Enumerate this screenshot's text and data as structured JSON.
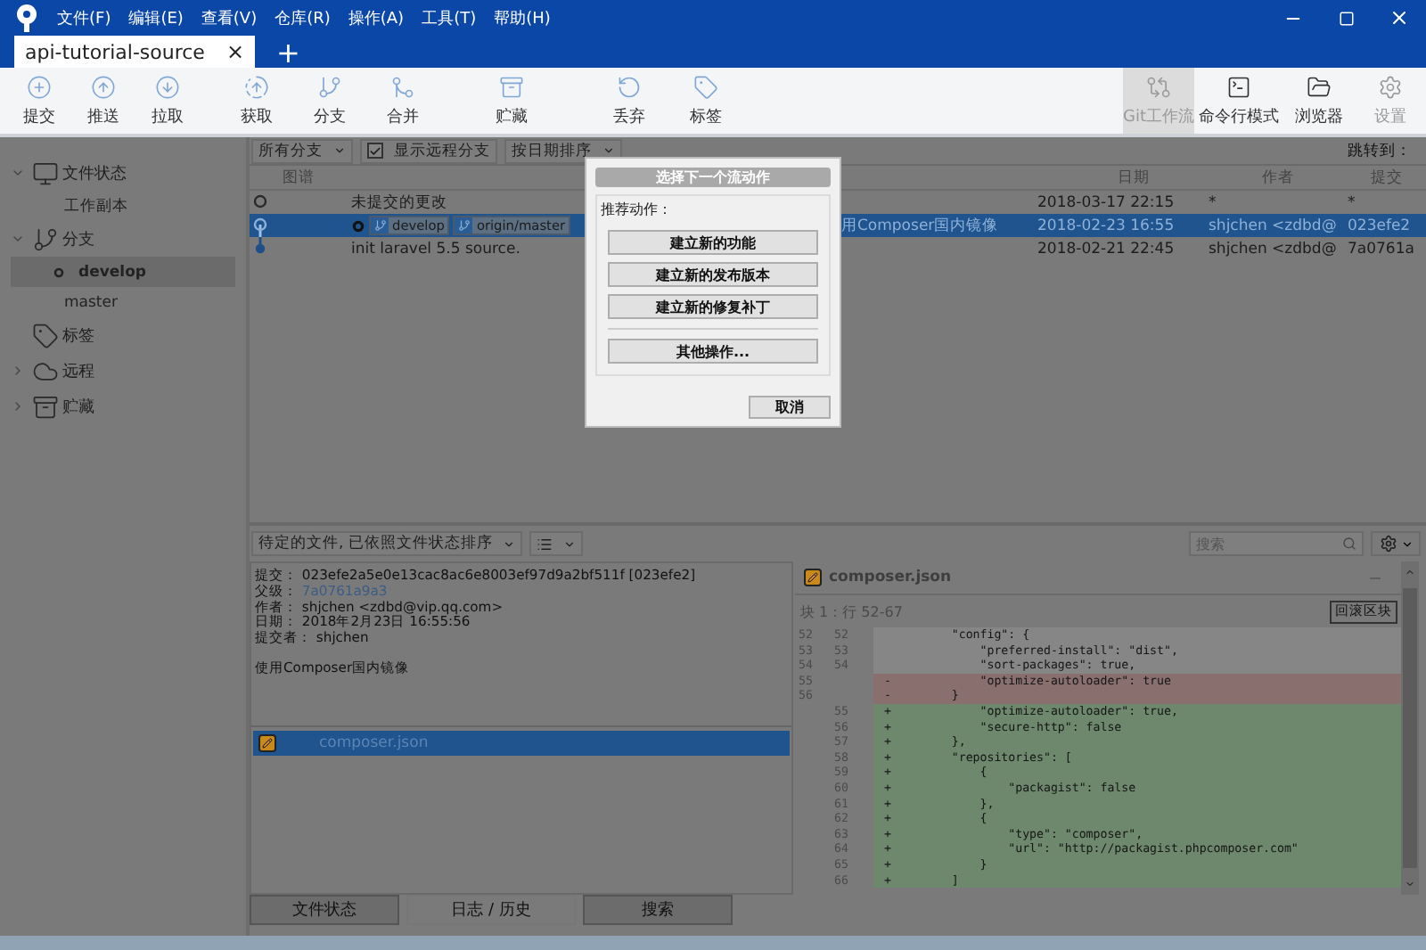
{
  "menu": [
    "文件(F)",
    "编辑(E)",
    "查看(V)",
    "仓库(R)",
    "操作(A)",
    "工具(T)",
    "帮助(H)"
  ],
  "tabs": [
    {
      "label": "api-tutorial-source",
      "selected": true,
      "close": "×"
    },
    {
      "label": "+",
      "selected": false
    }
  ],
  "toolbar": {
    "left": [
      {
        "label": "提交"
      },
      {
        "label": "推送"
      },
      {
        "label": "拉取"
      },
      {
        "label": "获取"
      },
      {
        "label": "分支"
      },
      {
        "label": "合并"
      },
      {
        "label": "贮藏"
      },
      {
        "label": "丢弃"
      },
      {
        "label": "标签"
      }
    ],
    "right": [
      {
        "label": "Git工作流",
        "selected": true,
        "disabled": true
      },
      {
        "label": "命令行模式",
        "selected": false,
        "disabled": false
      },
      {
        "label": "浏览器",
        "selected": false,
        "disabled": false
      },
      {
        "label": "设置",
        "selected": false,
        "disabled": true
      }
    ]
  },
  "sidebar": [
    {
      "label": "文件状态",
      "expanded": true,
      "children": [
        {
          "label": "工作副本",
          "selected": false,
          "current": false
        }
      ]
    },
    {
      "label": "分支",
      "expanded": true,
      "children": [
        {
          "label": "develop",
          "selected": true,
          "current": true
        },
        {
          "label": "master",
          "selected": false,
          "current": false
        }
      ]
    },
    {
      "label": "标签"
    },
    {
      "label": "远程",
      "expanded": false
    },
    {
      "label": "贮藏",
      "expanded": false
    }
  ],
  "filter_bar": {
    "branches": "所有分支",
    "show_remote": {
      "label": "显示远程分支",
      "checked": true
    },
    "sort": "按日期排序",
    "jump_label": "跳转到："
  },
  "table": {
    "columns": {
      "graph": "图谱",
      "date": "日期",
      "author": "作者",
      "commit": "提交"
    },
    "rows": [
      {
        "kind": "uncommitted",
        "description": "未提交的更改",
        "date": "2018-03-17 22:15",
        "author": "*",
        "commit": "*",
        "selected": false,
        "refs": []
      },
      {
        "kind": "commit",
        "head": true,
        "description": "用Composer国内镜像",
        "date": "2018-02-23 16:55",
        "author": "shjchen <zdbd@",
        "commit": "023efe2",
        "selected": true,
        "refs": [
          "develop",
          "origin/master"
        ]
      },
      {
        "kind": "commit",
        "description": "init laravel 5.5 source.",
        "date": "2018-02-21 22:45",
        "author": "shjchen <zdbd@",
        "commit": "7a0761a",
        "selected": false,
        "refs": []
      }
    ]
  },
  "lower_toolbar": {
    "file_sort": "待定的文件, 已依照文件状态排序",
    "search": {
      "placeholder": "搜索"
    }
  },
  "details": {
    "fields": [
      {
        "label": "提交：",
        "value": "023efe2a5e0e13cac8ac6e8003ef97d9a2bf511f [023efe2]",
        "link": false
      },
      {
        "label": "父级：",
        "value": "7a0761a9a3",
        "link": true
      },
      {
        "label": "作者：",
        "value": "shjchen <zdbd@vip.qq.com>",
        "link": false
      },
      {
        "label": "日期：",
        "value": "2018年2月23日 16:55:56",
        "link": false
      },
      {
        "label": "提交者：",
        "value": "shjchen",
        "link": false
      }
    ],
    "message": "使用Composer国内镜像"
  },
  "files": [
    {
      "name": "composer.json",
      "kind": "modified",
      "selected": true
    }
  ],
  "diff": {
    "file": "composer.json",
    "hunk": "块 1：行 52-67",
    "revert": "回滚区块",
    "lines": [
      {
        "kind": "context",
        "old": "52",
        "new": "52",
        "text": "    \"config\": {"
      },
      {
        "kind": "context",
        "old": "53",
        "new": "53",
        "text": "        \"preferred-install\": \"dist\","
      },
      {
        "kind": "context",
        "old": "54",
        "new": "54",
        "text": "        \"sort-packages\": true,"
      },
      {
        "kind": "removed",
        "old": "55",
        "sign": "-",
        "text": "        \"optimize-autoloader\": true"
      },
      {
        "kind": "removed",
        "old": "56",
        "sign": "-",
        "text": "    }"
      },
      {
        "kind": "added",
        "new": "55",
        "sign": "+",
        "text": "        \"optimize-autoloader\": true,"
      },
      {
        "kind": "added",
        "new": "56",
        "sign": "+",
        "text": "        \"secure-http\": false"
      },
      {
        "kind": "added",
        "new": "57",
        "sign": "+",
        "text": "    },"
      },
      {
        "kind": "added",
        "new": "58",
        "sign": "+",
        "text": "    \"repositories\": ["
      },
      {
        "kind": "added",
        "new": "59",
        "sign": "+",
        "text": "        {"
      },
      {
        "kind": "added",
        "new": "60",
        "sign": "+",
        "text": "            \"packagist\": false"
      },
      {
        "kind": "added",
        "new": "61",
        "sign": "+",
        "text": "        },"
      },
      {
        "kind": "added",
        "new": "62",
        "sign": "+",
        "text": "        {"
      },
      {
        "kind": "added",
        "new": "63",
        "sign": "+",
        "text": "            \"type\": \"composer\","
      },
      {
        "kind": "added",
        "new": "64",
        "sign": "+",
        "text": "            \"url\": \"http://packagist.phpcomposer.com\""
      },
      {
        "kind": "added",
        "new": "65",
        "sign": "+",
        "text": "        }"
      },
      {
        "kind": "added",
        "new": "66",
        "sign": "+",
        "text": "    ]"
      }
    ]
  },
  "bottom_tabs": [
    {
      "label": "文件状态",
      "selected": false
    },
    {
      "label": "日志 / 历史",
      "selected": true
    },
    {
      "label": "搜索",
      "selected": false
    }
  ],
  "dialog": {
    "title": "选择下一个流动作",
    "group": "推荐动作：",
    "actions": [
      "建立新的功能",
      "建立新的发布版本",
      "建立新的修复补丁"
    ],
    "other": "其他操作...",
    "cancel": "取消"
  }
}
